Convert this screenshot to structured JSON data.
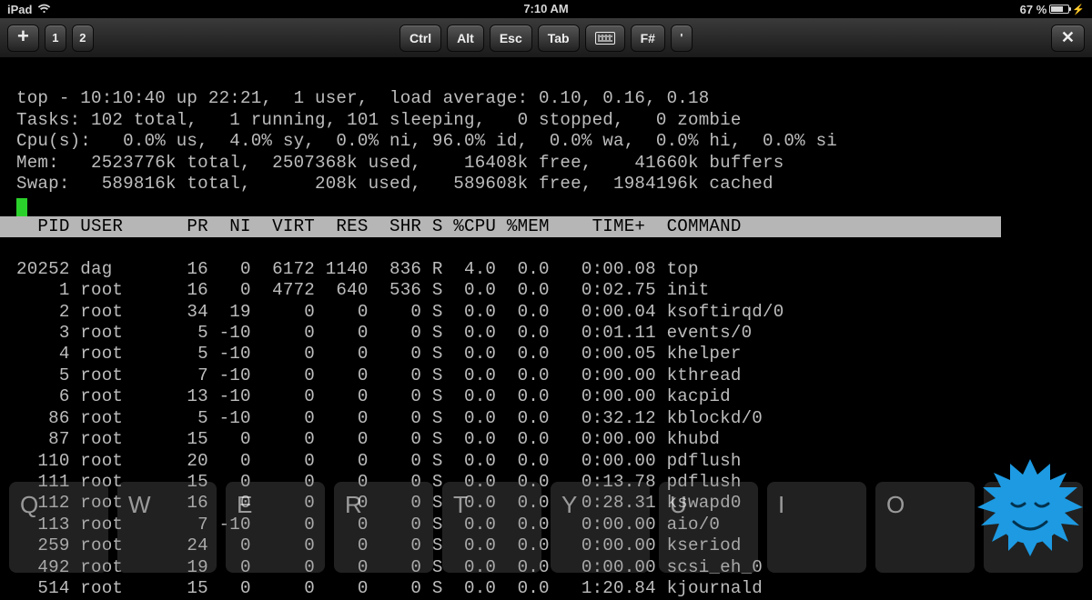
{
  "statusbar": {
    "device": "iPad",
    "time": "7:10 AM",
    "battery_pct": "67 %"
  },
  "toolbar": {
    "plus": "+",
    "tab1": "1",
    "tab2": "2",
    "ctrl": "Ctrl",
    "alt": "Alt",
    "esc": "Esc",
    "tab": "Tab",
    "fkey": "F#",
    "apostrophe": "'",
    "close": "✕"
  },
  "top": {
    "line1": "top - 10:10:40 up 22:21,  1 user,  load average: 0.10, 0.16, 0.18",
    "line2": "Tasks: 102 total,   1 running, 101 sleeping,   0 stopped,   0 zombie",
    "line3": "Cpu(s):   0.0% us,  4.0% sy,  0.0% ni, 96.0% id,  0.0% wa,  0.0% hi,  0.0% si",
    "line4": "Mem:   2523776k total,  2507368k used,    16408k free,    41660k buffers",
    "line5": "Swap:   589816k total,      208k used,   589608k free,  1984196k cached",
    "header": "  PID USER      PR  NI  VIRT  RES  SHR S %CPU %MEM    TIME+  COMMAND",
    "rows": [
      "20252 dag       16   0  6172 1140  836 R  4.0  0.0   0:00.08 top",
      "    1 root      16   0  4772  640  536 S  0.0  0.0   0:02.75 init",
      "    2 root      34  19     0    0    0 S  0.0  0.0   0:00.04 ksoftirqd/0",
      "    3 root       5 -10     0    0    0 S  0.0  0.0   0:01.11 events/0",
      "    4 root       5 -10     0    0    0 S  0.0  0.0   0:00.05 khelper",
      "    5 root       7 -10     0    0    0 S  0.0  0.0   0:00.00 kthread",
      "    6 root      13 -10     0    0    0 S  0.0  0.0   0:00.00 kacpid",
      "   86 root       5 -10     0    0    0 S  0.0  0.0   0:32.12 kblockd/0",
      "   87 root      15   0     0    0    0 S  0.0  0.0   0:00.00 khubd",
      "  110 root      20   0     0    0    0 S  0.0  0.0   0:00.00 pdflush",
      "  111 root      15   0     0    0    0 S  0.0  0.0   0:13.78 pdflush",
      "  112 root      16   0     0    0    0 S  0.0  0.0   0:28.31 kswapd0",
      "  113 root       7 -10     0    0    0 S  0.0  0.0   0:00.00 aio/0",
      "  259 root      24   0     0    0    0 S  0.0  0.0   0:00.00 kseriod",
      "  492 root      19   0     0    0    0 S  0.0  0.0   0:00.00 scsi_eh_0",
      "  514 root      15   0     0    0    0 S  0.0  0.0   1:20.84 kjournald"
    ]
  },
  "osk": {
    "keys": [
      "Q",
      "W",
      "E",
      "R",
      "T",
      "Y",
      "U",
      "I",
      "O",
      "P"
    ]
  }
}
